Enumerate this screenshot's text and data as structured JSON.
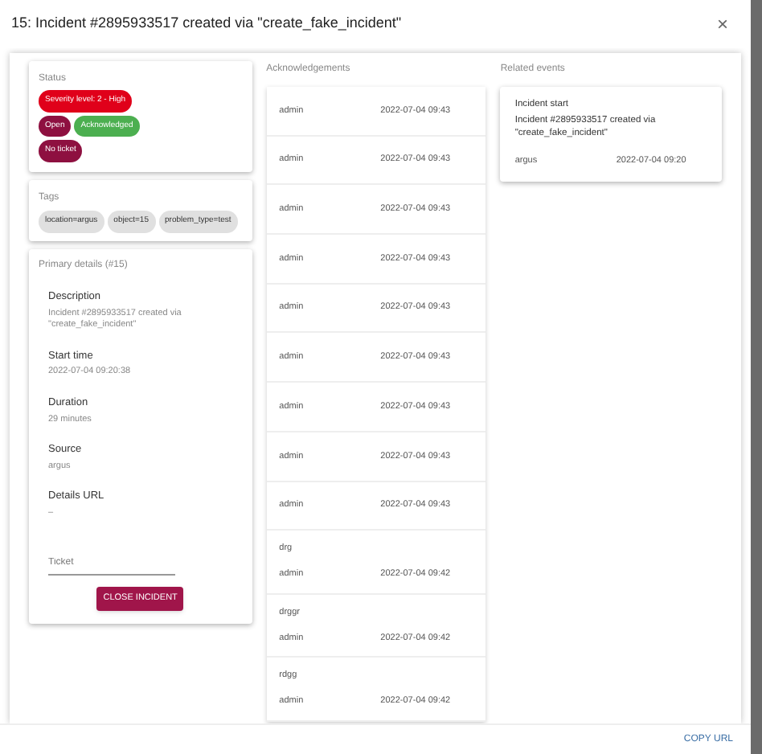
{
  "dialog": {
    "title": "15: Incident #2895933517 created via \"create_fake_incident\"",
    "close": "×"
  },
  "status": {
    "heading": "Status",
    "chip_rows": [
      [
        {
          "label": "Severity level: 2 - High",
          "color": "#e0001a"
        }
      ],
      [
        {
          "label": "Open",
          "color": "#8e1040"
        },
        {
          "label": "Acknowledged",
          "color": "#4caf50"
        }
      ],
      [
        {
          "label": "No ticket",
          "color": "#8e1040"
        }
      ]
    ]
  },
  "tags": {
    "heading": "Tags",
    "items": [
      "location=argus",
      "object=15",
      "problem_type=test"
    ]
  },
  "primary_details": {
    "heading": "Primary details (#15)",
    "fields": [
      {
        "label": "Description",
        "value": "Incident #2895933517 created via \"create_fake_incident\""
      },
      {
        "label": "Start time",
        "value": "2022-07-04 09:20:38"
      },
      {
        "label": "Duration",
        "value": "29 minutes"
      },
      {
        "label": "Source",
        "value": "argus"
      },
      {
        "label": "Details URL",
        "value": "–"
      }
    ],
    "ticket_placeholder": "Ticket",
    "close_button": "CLOSE INCIDENT"
  },
  "acknowledgements": {
    "heading": "Acknowledgements",
    "items": [
      {
        "user": "admin",
        "time": "2022-07-04 09:43"
      },
      {
        "user": "admin",
        "time": "2022-07-04 09:43"
      },
      {
        "user": "admin",
        "time": "2022-07-04 09:43"
      },
      {
        "user": "admin",
        "time": "2022-07-04 09:43"
      },
      {
        "user": "admin",
        "time": "2022-07-04 09:43"
      },
      {
        "user": "admin",
        "time": "2022-07-04 09:43"
      },
      {
        "user": "admin",
        "time": "2022-07-04 09:43"
      },
      {
        "user": "admin",
        "time": "2022-07-04 09:43"
      },
      {
        "user": "admin",
        "time": "2022-07-04 09:43"
      },
      {
        "comment": "drg",
        "user": "admin",
        "time": "2022-07-04 09:42"
      },
      {
        "comment": "drggr",
        "user": "admin",
        "time": "2022-07-04 09:42"
      },
      {
        "comment": "rdgg",
        "user": "admin",
        "time": "2022-07-04 09:42"
      }
    ]
  },
  "related_events": {
    "heading": "Related events",
    "items": [
      {
        "title": "Incident start",
        "description": "Incident #2895933517 created via \"create_fake_incident\"",
        "actor": "argus",
        "time": "2022-07-04 09:20"
      }
    ]
  },
  "footer": {
    "copy_url": "COPY URL"
  }
}
